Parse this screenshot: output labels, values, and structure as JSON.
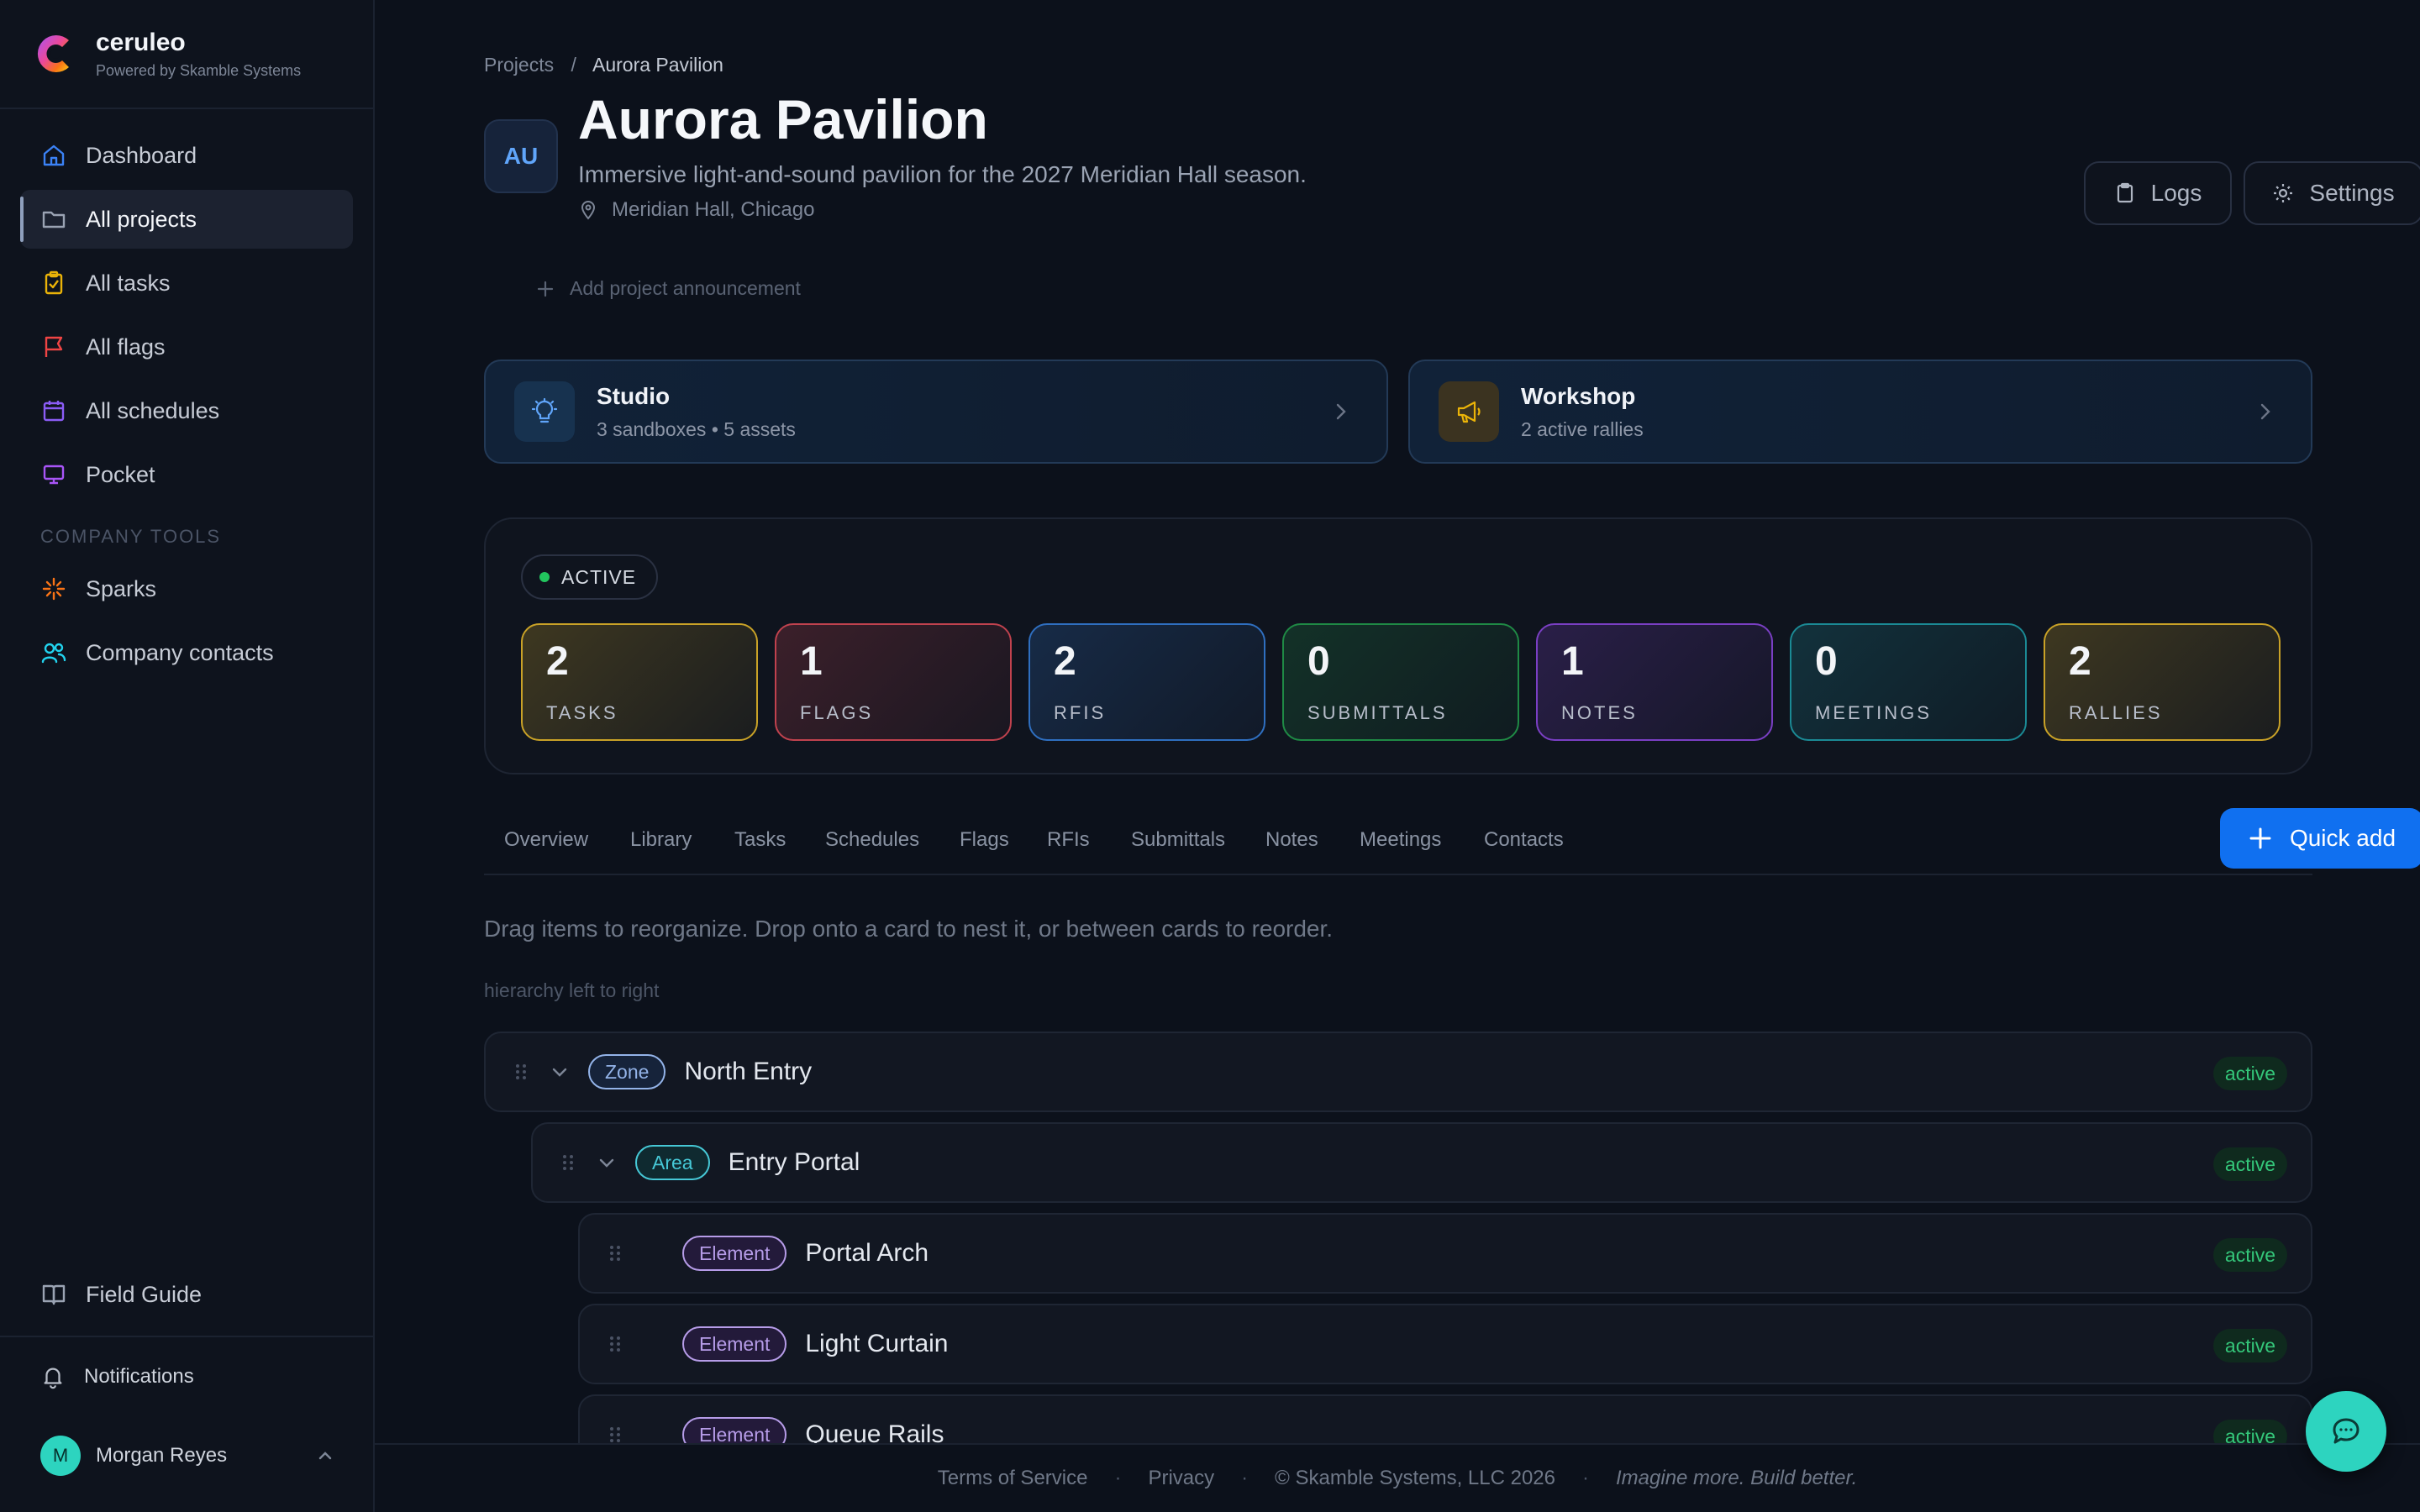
{
  "brand": {
    "name": "ceruleo",
    "subtitle": "Powered by Skamble Systems"
  },
  "nav": {
    "items": [
      {
        "label": "Dashboard",
        "icon": "home-icon",
        "color": "#3b82f6"
      },
      {
        "label": "All projects",
        "icon": "folder-icon",
        "color": "#9aa3b3",
        "active": true
      },
      {
        "label": "All tasks",
        "icon": "clipboard-check-icon",
        "color": "#eab308"
      },
      {
        "label": "All flags",
        "icon": "flag-icon",
        "color": "#ef4444"
      },
      {
        "label": "All schedules",
        "icon": "calendar-icon",
        "color": "#8b5cf6"
      },
      {
        "label": "Pocket",
        "icon": "monitor-icon",
        "color": "#a855f7"
      }
    ],
    "section_label": "COMPANY TOOLS",
    "tools": [
      {
        "label": "Sparks",
        "icon": "sparkle-icon",
        "color": "#f97316"
      },
      {
        "label": "Company contacts",
        "icon": "users-icon",
        "color": "#22d3ee"
      }
    ],
    "field_guide": "Field Guide",
    "notifications": "Notifications",
    "user": {
      "initial": "M",
      "name": "Morgan Reyes"
    }
  },
  "breadcrumb": {
    "root": "Projects",
    "separator": "/",
    "current": "Aurora Pavilion"
  },
  "project": {
    "initials": "AU",
    "title": "Aurora Pavilion",
    "description": "Immersive light-and-sound pavilion for the 2027 Meridian Hall season.",
    "location": "Meridian Hall, Chicago",
    "announcement_placeholder": "Add project announcement"
  },
  "header_buttons": {
    "logs": "Logs",
    "settings": "Settings"
  },
  "cards": {
    "studio": {
      "title": "Studio",
      "subtitle": "3 sandboxes • 5 assets"
    },
    "workshop": {
      "title": "Workshop",
      "subtitle": "2 active rallies"
    }
  },
  "status_pill": "ACTIVE",
  "stats": [
    {
      "value": "2",
      "label": "TASKS",
      "color": "#c9a227"
    },
    {
      "value": "1",
      "label": "FLAGS",
      "color": "#c0424e"
    },
    {
      "value": "2",
      "label": "RFIS",
      "color": "#2f6fc0"
    },
    {
      "value": "0",
      "label": "SUBMITTALS",
      "color": "#1f8a45"
    },
    {
      "value": "1",
      "label": "NOTES",
      "color": "#7a3fc4"
    },
    {
      "value": "0",
      "label": "MEETINGS",
      "color": "#1b8a95"
    },
    {
      "value": "2",
      "label": "RALLIES",
      "color": "#c9a227"
    }
  ],
  "tabs": [
    "Overview",
    "Library",
    "Tasks",
    "Schedules",
    "Flags",
    "RFIs",
    "Submittals",
    "Notes",
    "Meetings",
    "Contacts"
  ],
  "quick_add": "Quick add",
  "help_text": "Drag items to reorganize. Drop onto a card to nest it, or between cards to reorder.",
  "hierarchy_label": "hierarchy left to right",
  "rows": [
    {
      "badge": "Zone",
      "name": "North Entry",
      "status": "active"
    },
    {
      "badge": "Area",
      "name": "Entry Portal",
      "status": "active"
    },
    {
      "badge": "Element",
      "name": "Portal Arch",
      "status": "active"
    },
    {
      "badge": "Element",
      "name": "Light Curtain",
      "status": "active"
    },
    {
      "badge": "Element",
      "name": "Queue Rails",
      "status": "active"
    }
  ],
  "footer": {
    "terms": "Terms of Service",
    "privacy": "Privacy",
    "copyright": "© Skamble Systems, LLC 2026",
    "tagline": "Imagine more. Build better.",
    "separator": "·"
  }
}
